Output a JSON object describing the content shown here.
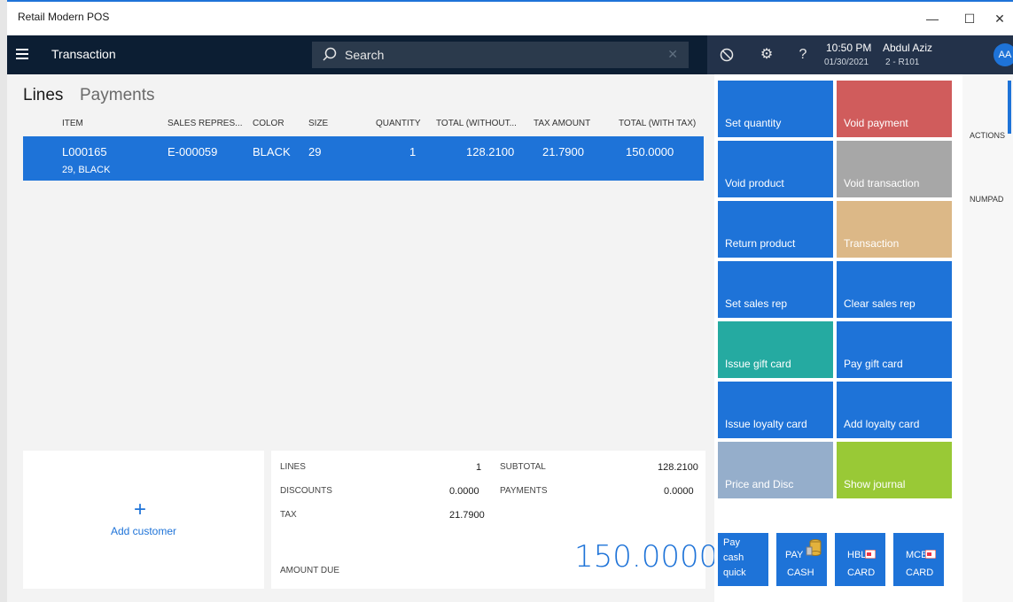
{
  "window": {
    "title": "Retail Modern POS",
    "minimize": "—",
    "maximize": "☐",
    "close": "✕"
  },
  "appbar": {
    "title": "Transaction",
    "search_placeholder": "Search",
    "time": "10:50 PM",
    "date": "01/30/2021",
    "user": "Abdul Aziz",
    "store": "2 - R101",
    "avatar_initials": "AA"
  },
  "tabs": {
    "lines": "Lines",
    "payments": "Payments"
  },
  "table": {
    "headers": [
      "ITEM",
      "SALES REPRES...",
      "COLOR",
      "SIZE",
      "QUANTITY",
      "TOTAL (WITHOUT...",
      "TAX AMOUNT",
      "TOTAL (WITH TAX)"
    ],
    "rows": [
      {
        "item": "L000165",
        "item_sub": "29, BLACK",
        "sales_rep": "E-000059",
        "color": "BLACK",
        "size": "29",
        "quantity": "1",
        "total_without": "128.2100",
        "tax_amount": "21.7900",
        "total_with_tax": "150.0000"
      }
    ]
  },
  "customer": {
    "plus": "+",
    "label": "Add customer"
  },
  "totals": {
    "lines_label": "LINES",
    "lines_value": "1",
    "discounts_label": "DISCOUNTS",
    "discounts_value": "0.0000",
    "tax_label": "TAX",
    "tax_value": "21.7900",
    "subtotal_label": "SUBTOTAL",
    "subtotal_value": "128.2100",
    "payments_label": "PAYMENTS",
    "payments_value": "0.0000",
    "amount_due_label": "AMOUNT DUE",
    "amount_due_value": "150.0000"
  },
  "tiles": [
    {
      "label": "Set quantity",
      "color": "#1e73d8"
    },
    {
      "label": "Void payment",
      "color": "#d05c5c"
    },
    {
      "label": "Void product",
      "color": "#1e73d8"
    },
    {
      "label": "Void transaction",
      "color": "#a7a7a7"
    },
    {
      "label": "Return product",
      "color": "#1e73d8"
    },
    {
      "label": "Transaction",
      "color": "#dcb887"
    },
    {
      "label": "Set sales rep",
      "color": "#1e73d8"
    },
    {
      "label": "Clear sales rep",
      "color": "#1e73d8"
    },
    {
      "label": "Issue gift card",
      "color": "#25aaa1"
    },
    {
      "label": "Pay gift card",
      "color": "#1e73d8"
    },
    {
      "label": "Issue loyalty card",
      "color": "#1e73d8"
    },
    {
      "label": "Add loyalty card",
      "color": "#1e73d8"
    },
    {
      "label": "Price and Disc",
      "color": "#95aecb"
    },
    {
      "label": "Show journal",
      "color": "#99c936"
    }
  ],
  "payment_tiles": [
    {
      "line1": "Pay",
      "line2": "cash",
      "line3": "quick"
    },
    {
      "line1": "PAY",
      "line2": "CASH"
    },
    {
      "line1": "HBL",
      "line2": "CARD"
    },
    {
      "line1": "MCB",
      "line2": "CARD"
    }
  ],
  "rightrail": {
    "actions": "ACTIONS",
    "numpad": "NUMPAD"
  }
}
